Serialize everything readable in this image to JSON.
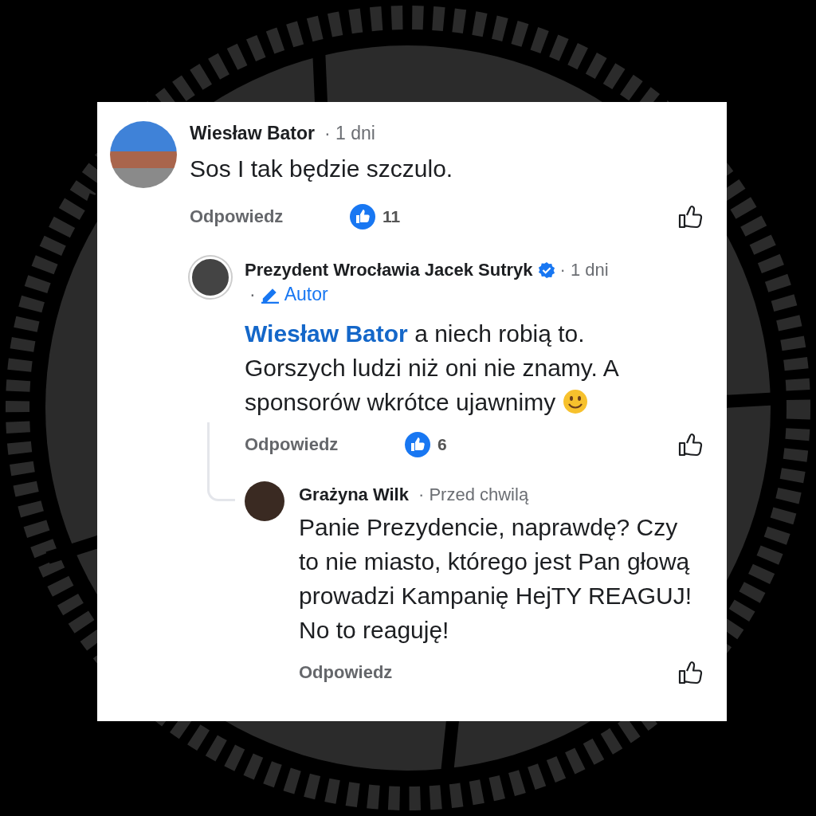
{
  "comments": [
    {
      "author": "Wiesław Bator",
      "time": "· 1 dni",
      "verified": false,
      "text": "Sos I tak będzie szczulo.",
      "reply": "Odpowiedz",
      "reaction_count": "11",
      "children": [
        {
          "author": "Prezydent Wrocławia Jacek Sutryk",
          "time": "· 1 dni",
          "verified": true,
          "badge": {
            "prefix": "·",
            "label": "Autor"
          },
          "mention": "Wiesław Bator",
          "text": "a niech robią to. Gorszych ludzi niż oni nie znamy. A sponsorów wkrótce ujawnimy",
          "emoji": true,
          "reply": "Odpowiedz",
          "reaction_count": "6",
          "children": [
            {
              "author": "Grażyna Wilk",
              "time": "· Przed chwilą",
              "verified": false,
              "text": "Panie Prezydencie, naprawdę? Czy to nie miasto, którego jest Pan głową prowadzi Kampanię HejTY REAGUJ! No to reaguję!",
              "reply": "Odpowiedz"
            }
          ]
        }
      ]
    }
  ]
}
